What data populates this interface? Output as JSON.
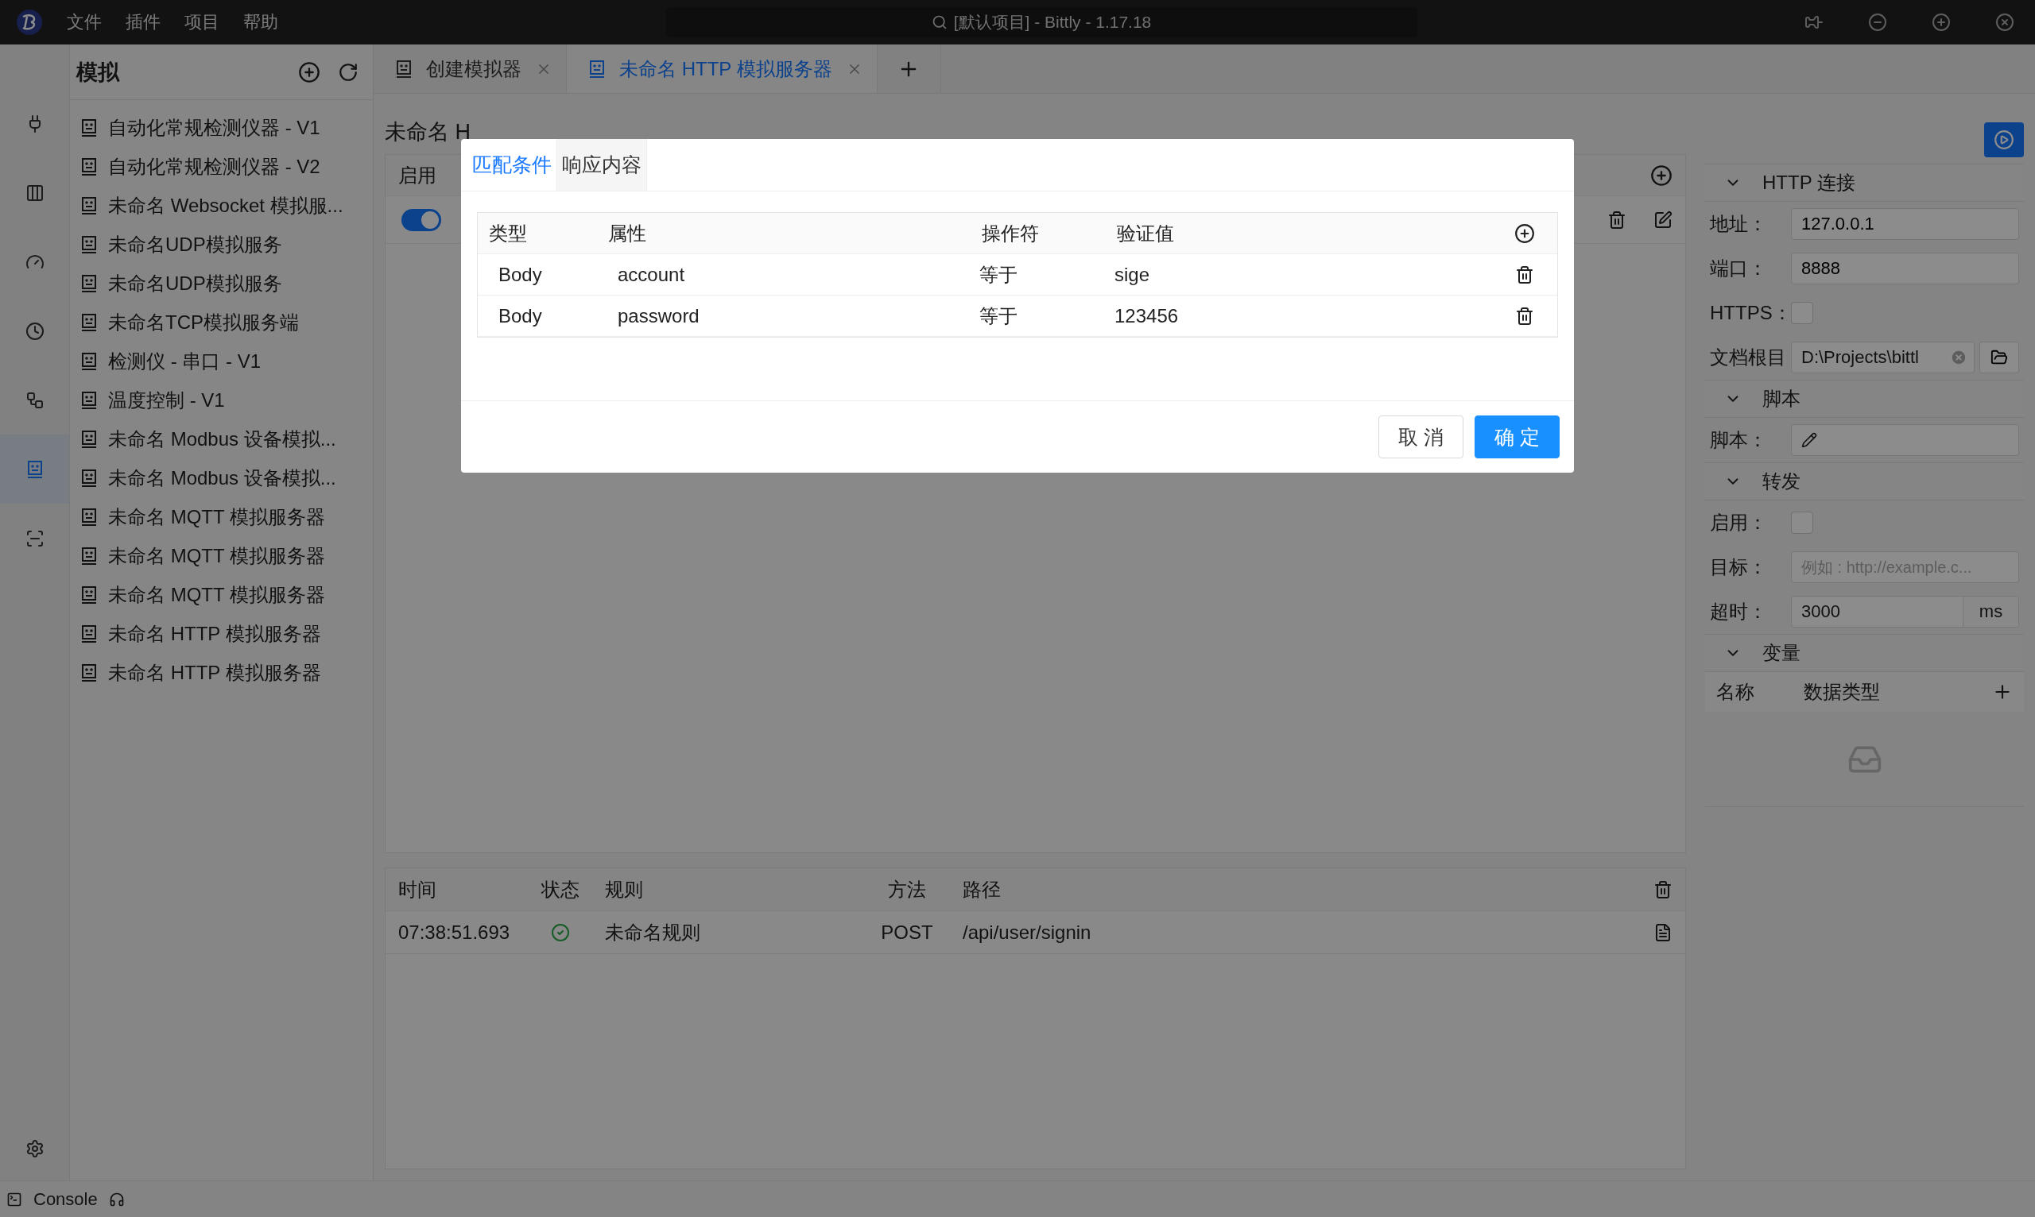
{
  "title_bar": {
    "menu": [
      "文件",
      "插件",
      "项目",
      "帮助"
    ],
    "search": "[默认项目] - Bittly - 1.17.18"
  },
  "activity_bar": [
    {
      "selected": false
    },
    {
      "selected": false
    },
    {
      "selected": false
    },
    {
      "selected": false
    },
    {
      "selected": false
    },
    {
      "selected": true
    },
    {
      "selected": false
    }
  ],
  "sidebar": {
    "title": "模拟",
    "items": [
      "自动化常规检测仪器 - V1",
      "自动化常规检测仪器 - V2",
      "未命名 Websocket 模拟服...",
      "未命名UDP模拟服务",
      "未命名UDP模拟服务",
      "未命名TCP模拟服务端",
      "检测仪 - 串口 - V1",
      "温度控制 - V1",
      "未命名 Modbus 设备模拟...",
      "未命名 Modbus 设备模拟...",
      "未命名 MQTT 模拟服务器",
      "未命名 MQTT 模拟服务器",
      "未命名 MQTT 模拟服务器",
      "未命名 HTTP 模拟服务器",
      "未命名 HTTP 模拟服务器"
    ]
  },
  "tabs": [
    {
      "label": "创建模拟器",
      "selected": false
    },
    {
      "label": "未命名 HTTP 模拟服务器",
      "selected": true
    }
  ],
  "editor": {
    "title": "未命名 H",
    "columns": [
      "启用"
    ],
    "rows": [
      {
        "enabled": true
      }
    ]
  },
  "log": {
    "columns": [
      "时间",
      "状态",
      "规则",
      "方法",
      "路径"
    ],
    "rows": [
      {
        "time": "07:38:51.693",
        "ok": true,
        "rule": "未命名规则",
        "method": "POST",
        "path": "/api/user/signin"
      }
    ]
  },
  "settings": [
    {
      "title": "HTTP 连接",
      "expanded": true,
      "fields": [
        {
          "kind": "text",
          "label": "地址：",
          "value": "127.0.0.1"
        },
        {
          "kind": "text",
          "label": "端口：",
          "value": "8888"
        },
        {
          "kind": "checkbox",
          "label": "HTTPS：",
          "checked": false
        },
        {
          "kind": "path",
          "label": "文档根目",
          "value": "D:\\Projects\\bittl"
        }
      ]
    },
    {
      "title": "脚本",
      "expanded": true,
      "fields": [
        {
          "kind": "script",
          "label": "脚本："
        }
      ]
    },
    {
      "title": "转发",
      "expanded": true,
      "fields": [
        {
          "kind": "checkbox",
          "label": "启用：",
          "checked": false
        },
        {
          "kind": "text",
          "label": "目标：",
          "placeholder": "例如 : http://example.c..."
        },
        {
          "kind": "unit",
          "label": "超时：",
          "value": "3000",
          "unit": "ms"
        }
      ]
    },
    {
      "title": "变量",
      "expanded": true,
      "columns": [
        "名称",
        "数据类型"
      ]
    }
  ],
  "dialog": {
    "tabs": [
      {
        "label": "匹配条件",
        "selected": true
      },
      {
        "label": "响应内容",
        "selected": false
      }
    ],
    "columns": [
      "类型",
      "属性",
      "操作符",
      "验证值"
    ],
    "rows": [
      {
        "type": "Body",
        "property": "account",
        "operator": "等于",
        "value": "sige"
      },
      {
        "type": "Body",
        "property": "password",
        "operator": "等于",
        "value": "123456"
      }
    ],
    "buttons": [
      {
        "label": "取 消",
        "kind": "default"
      },
      {
        "label": "确 定",
        "kind": "primary"
      }
    ]
  },
  "status_bar": {
    "console": "Console"
  }
}
